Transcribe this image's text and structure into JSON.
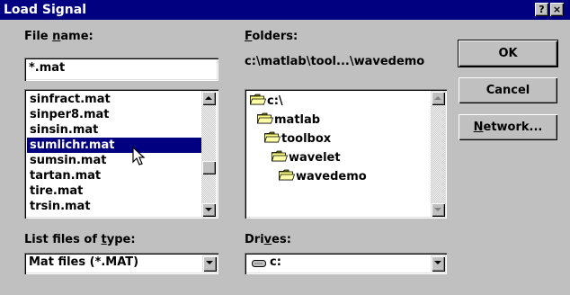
{
  "window": {
    "title": "Load Signal",
    "help_glyph": "?",
    "close_glyph": "×"
  },
  "filename": {
    "label_pre": "File ",
    "label_u": "n",
    "label_post": "ame:",
    "value": "*.mat",
    "files": [
      "sinfract.mat",
      "sinper8.mat",
      "sinsin.mat",
      "sumlichr.mat",
      "sumsin.mat",
      "tartan.mat",
      "tire.mat",
      "trsin.mat"
    ],
    "selected_index": 3
  },
  "folders": {
    "label_u": "F",
    "label_post": "olders:",
    "current_path": "c:\\matlab\\tool...\\wavedemo",
    "tree": [
      "c:\\",
      "matlab",
      "toolbox",
      "wavelet",
      "wavedemo"
    ]
  },
  "filetype": {
    "label_pre": "List files of ",
    "label_u": "t",
    "label_post": "ype:",
    "value": "Mat files (*.MAT)"
  },
  "drives": {
    "label_pre": "Dri",
    "label_u": "v",
    "label_post": "es:",
    "value": "c:"
  },
  "buttons": {
    "ok": "OK",
    "cancel": "Cancel",
    "network_u": "N",
    "network_post": "etwork..."
  },
  "colors": {
    "titlebar": "#000080",
    "face": "#c0c0c0",
    "selection": "#000080",
    "folder": "#ffff80"
  },
  "icons": {
    "drive": "drive-icon",
    "folder_open": "open-folder-icon",
    "cursor": "mouse-pointer-icon"
  }
}
